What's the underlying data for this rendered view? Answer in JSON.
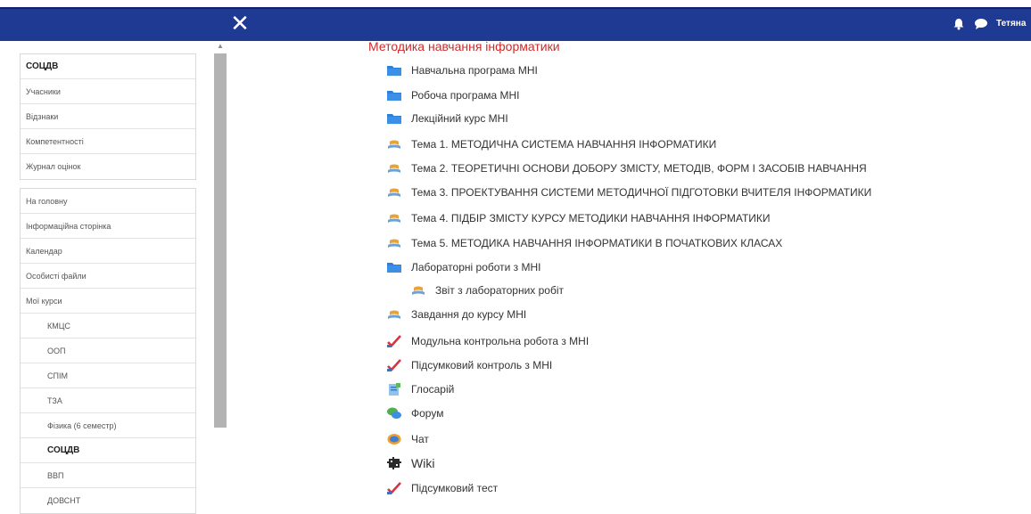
{
  "header": {
    "close_glyph": "✕",
    "user_name": "Тетяна",
    "icons": [
      "bell-icon",
      "chat-icon"
    ],
    "bar_color": "#1f3a93"
  },
  "sidebar": {
    "group1": [
      {
        "label": "СОЦДВ",
        "bold": true
      },
      {
        "label": "Учасники"
      },
      {
        "label": "Відзнаки"
      },
      {
        "label": "Компетентності"
      },
      {
        "label": "Журнал оцінок"
      }
    ],
    "group2": [
      {
        "label": "На головну"
      },
      {
        "label": "Інформаційна сторінка"
      },
      {
        "label": "Календар"
      },
      {
        "label": "Особисті файли"
      },
      {
        "label": "Мої курси"
      },
      {
        "label": "КМЦС",
        "sub": true
      },
      {
        "label": "ООП",
        "sub": true
      },
      {
        "label": "СПІМ",
        "sub": true
      },
      {
        "label": "ТЗА",
        "sub": true
      },
      {
        "label": "Фізика (6 семестр)",
        "sub": true
      },
      {
        "label": "СОЦДВ",
        "sub": true,
        "bold": true
      },
      {
        "label": "ВВП",
        "sub": true
      },
      {
        "label": "ДОВСНТ",
        "sub": true
      }
    ]
  },
  "course": {
    "title": "Методика навчання інформатики",
    "title_color": "#d02a2a",
    "activities": [
      {
        "label": "Навчальна програма МНІ",
        "icon": "folder-icon"
      },
      {
        "label": "Робоча програма МНІ",
        "icon": "folder-icon"
      },
      {
        "label": "Лекційний курс МНІ",
        "icon": "folder-icon"
      },
      {
        "label": "Тема 1. МЕТОДИЧНА СИСТЕМА НАВЧАННЯ ІНФОРМАТИКИ",
        "icon": "lesson-icon"
      },
      {
        "label": "Тема 2. ТЕОРЕТИЧНІ ОСНОВИ ДОБОРУ ЗМІСТУ, МЕТОДІВ, ФОРМ І ЗАСОБІВ НАВЧАННЯ",
        "icon": "lesson-icon"
      },
      {
        "label": "Тема 3. ПРОЕКТУВАННЯ СИСТЕМИ МЕТОДИЧНОЇ ПІДГОТОВКИ ВЧИТЕЛЯ ІНФОРМАТИКИ",
        "icon": "lesson-icon"
      },
      {
        "label": "Тема 4. ПІДБІР ЗМІСТУ КУРСУ МЕТОДИКИ НАВЧАННЯ ІНФОРМАТИКИ",
        "icon": "lesson-icon"
      },
      {
        "label": "Тема 5. МЕТОДИКА НАВЧАННЯ ІНФОРМАТИКИ В ПОЧАТКОВИХ КЛАСАХ",
        "icon": "lesson-icon"
      },
      {
        "label": "Лабораторні роботи з МНІ",
        "icon": "folder-icon"
      },
      {
        "label": "Звіт з лабораторних робіт",
        "icon": "lesson-icon",
        "indent": true
      },
      {
        "label": "Завдання до курсу МНІ",
        "icon": "lesson-icon"
      },
      {
        "label": "Модульна контрольна робота з МНІ",
        "icon": "quiz-icon"
      },
      {
        "label": "Підсумковий контроль з МНІ",
        "icon": "quiz-icon"
      },
      {
        "label": "Глосарій",
        "icon": "glossary-icon"
      },
      {
        "label": "Форум",
        "icon": "forum-icon"
      },
      {
        "label": "Чат",
        "icon": "chat-activity-icon"
      },
      {
        "label": "Wiki",
        "icon": "wiki-icon",
        "large": true
      },
      {
        "label": "Підсумковий тест",
        "icon": "quiz-icon"
      }
    ]
  }
}
